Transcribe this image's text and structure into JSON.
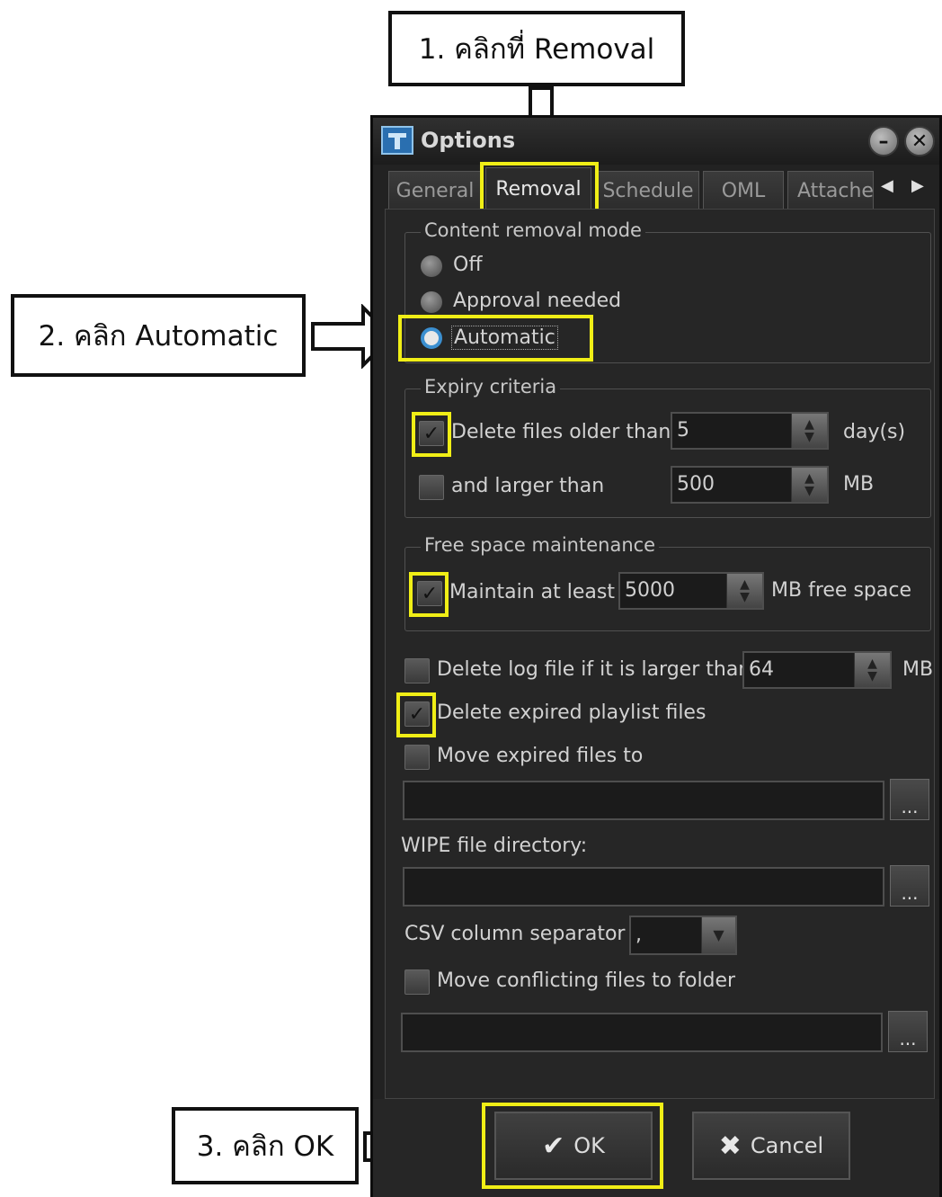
{
  "callouts": {
    "step1": "1. คลิกที่ Removal",
    "step2": "2. คลิก Automatic",
    "step3": "3. คลิก OK"
  },
  "window": {
    "title": "Options",
    "minimize_icon": "minimize-icon",
    "close_icon": "close-icon"
  },
  "tabs": [
    "General",
    "Removal",
    "Schedule",
    "OML",
    "Attache"
  ],
  "active_tab": "Removal",
  "content_removal_mode": {
    "label": "Content removal mode",
    "options": [
      "Off",
      "Approval needed",
      "Automatic"
    ],
    "selected": "Automatic"
  },
  "expiry_criteria": {
    "label": "Expiry criteria",
    "older": {
      "checked": true,
      "label": "Delete files older than",
      "value": "5",
      "unit": "day(s)"
    },
    "larger": {
      "checked": false,
      "label": "and larger than",
      "value": "500",
      "unit": "MB"
    }
  },
  "free_space": {
    "label": "Free space maintenance",
    "checked": true,
    "label_before": "Maintain at least",
    "value": "5000",
    "label_after": "MB free space"
  },
  "log_file": {
    "checked": false,
    "label": "Delete log file if it is larger than",
    "value": "64",
    "unit": "MB"
  },
  "expired_playlist": {
    "checked": true,
    "label": "Delete expired playlist files"
  },
  "move_expired": {
    "checked": false,
    "label": "Move expired files to",
    "path": ""
  },
  "wipe": {
    "label": "WIPE file directory:",
    "path": ""
  },
  "csv": {
    "label": "CSV column separator",
    "value": ","
  },
  "move_conflicting": {
    "checked": false,
    "label": "Move conflicting files to folder",
    "path": ""
  },
  "browse_label": "...",
  "buttons": {
    "ok": "OK",
    "cancel": "Cancel"
  },
  "highlight_color": "#f0ee16"
}
